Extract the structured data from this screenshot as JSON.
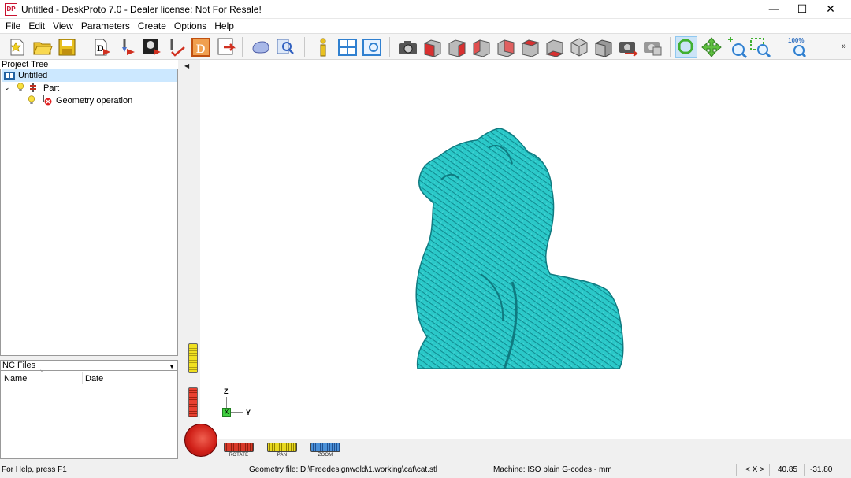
{
  "window": {
    "logo": "DP",
    "title": "Untitled - DeskProto 7.0 - Dealer license: Not For Resale!",
    "minimize": "—",
    "maximize": "☐",
    "close": "✕"
  },
  "menu": [
    "File",
    "Edit",
    "View",
    "Parameters",
    "Create",
    "Options",
    "Help"
  ],
  "toolbar": {
    "zoom_level": "100%",
    "more": "»",
    "icons": [
      "new-file-icon",
      "open-folder-icon",
      "save-icon",
      "operation-wizard-icon",
      "vector-wizard-icon",
      "bitmap-wizard-icon",
      "add-toolpath-icon",
      "d-icon",
      "export-icon",
      "simulation-icon",
      "inspect-icon",
      "info-icon",
      "layout-icon",
      "view-icon",
      "camera-icon",
      "view-front-icon",
      "view-back-icon",
      "view-left-icon",
      "view-right-icon",
      "view-top-icon",
      "view-bottom-icon",
      "view-iso-icon",
      "view-gray-icon",
      "screenshot-icon",
      "print-icon",
      "rotate-tool-icon",
      "pan-tool-icon",
      "zoom-tool-icon",
      "zoom-window-icon",
      "zoom-100-icon"
    ]
  },
  "project_tree": {
    "header": "Project Tree",
    "root": "Untitled",
    "part": "Part",
    "operation": "Geometry operation"
  },
  "nc_files": {
    "header": "NC Files",
    "columns": [
      "Name",
      "Date"
    ]
  },
  "viewport": {
    "axis_z": "Z",
    "axis_y": "Y",
    "axis_x": "X",
    "sliders": [
      {
        "label": "ROTATE",
        "color": "#d83a2a"
      },
      {
        "label": "PAN",
        "color": "#e8d820"
      },
      {
        "label": "ZOOM",
        "color": "#4a90d8"
      }
    ],
    "model_color": "#29c6c8"
  },
  "statusbar": {
    "help": "For Help, press F1",
    "geometry": "Geometry file: D:\\Freedesignwold\\1.working\\cat\\cat.stl",
    "machine": "Machine: ISO plain G-codes - mm",
    "axis": "< X >",
    "coord1": "40.85",
    "coord2": "-31.80"
  }
}
